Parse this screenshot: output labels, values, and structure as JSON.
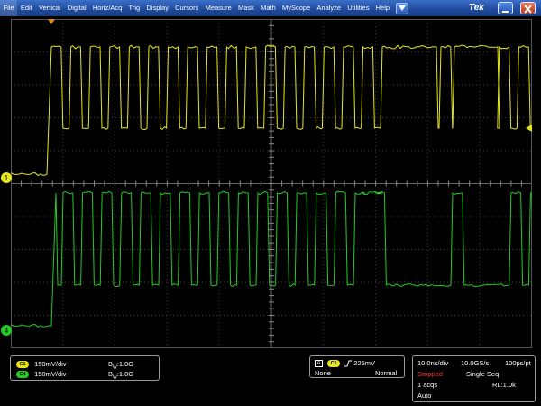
{
  "menubar": {
    "items": [
      "File",
      "Edit",
      "Vertical",
      "Digital",
      "Horiz/Acq",
      "Trig",
      "Display",
      "Cursors",
      "Measure",
      "Mask",
      "Math",
      "MyScope",
      "Analyze",
      "Utilities",
      "Help"
    ],
    "brand": "Tek"
  },
  "markers": {
    "ch1": "1",
    "ch4": "4"
  },
  "vertical_panel": {
    "ch1_badge": "C1",
    "ch1_scale": "150mV/div",
    "ch1_bw": "B",
    "ch1_bw_sub": "W",
    "ch1_bw_val": ":1.0G",
    "ch4_badge": "C4",
    "ch4_scale": "150mV/div",
    "ch4_bw": "B",
    "ch4_bw_sub": "W",
    "ch4_bw_val": ":1.0G"
  },
  "trigger_panel": {
    "type_icon": "A",
    "source_badge": "C1",
    "slope_icon": "rising-edge-icon",
    "level": "225mV",
    "coupling": "None",
    "mode": "Normal"
  },
  "horizontal_panel": {
    "scale": "10.0ns/div",
    "sample_rate": "10.0GS/s",
    "resolution": "100ps/pt",
    "run_state": "Stopped",
    "acq_mode": "Single Seq",
    "acq_count": "1 acqs",
    "record_length": "RL:1.0k",
    "trigger_mode": "Auto"
  },
  "colors": {
    "ch1": "#e6e61a",
    "ch4": "#22cc22",
    "menubar": "#1f4a9c",
    "stopped": "#ff3030"
  },
  "waveforms": {
    "ch1": {
      "edge_start_div": 0.35,
      "periods_div": 0.72,
      "high_div": 1.9,
      "low_div": 1.6,
      "baseline_div": 5.15,
      "note": "clock-like square wave; long high segments near 7.5 and 9.0 div"
    },
    "ch4": {
      "edge_start_div": 0.35,
      "periods_div": 0.72,
      "baseline_div": 9.0
    }
  }
}
